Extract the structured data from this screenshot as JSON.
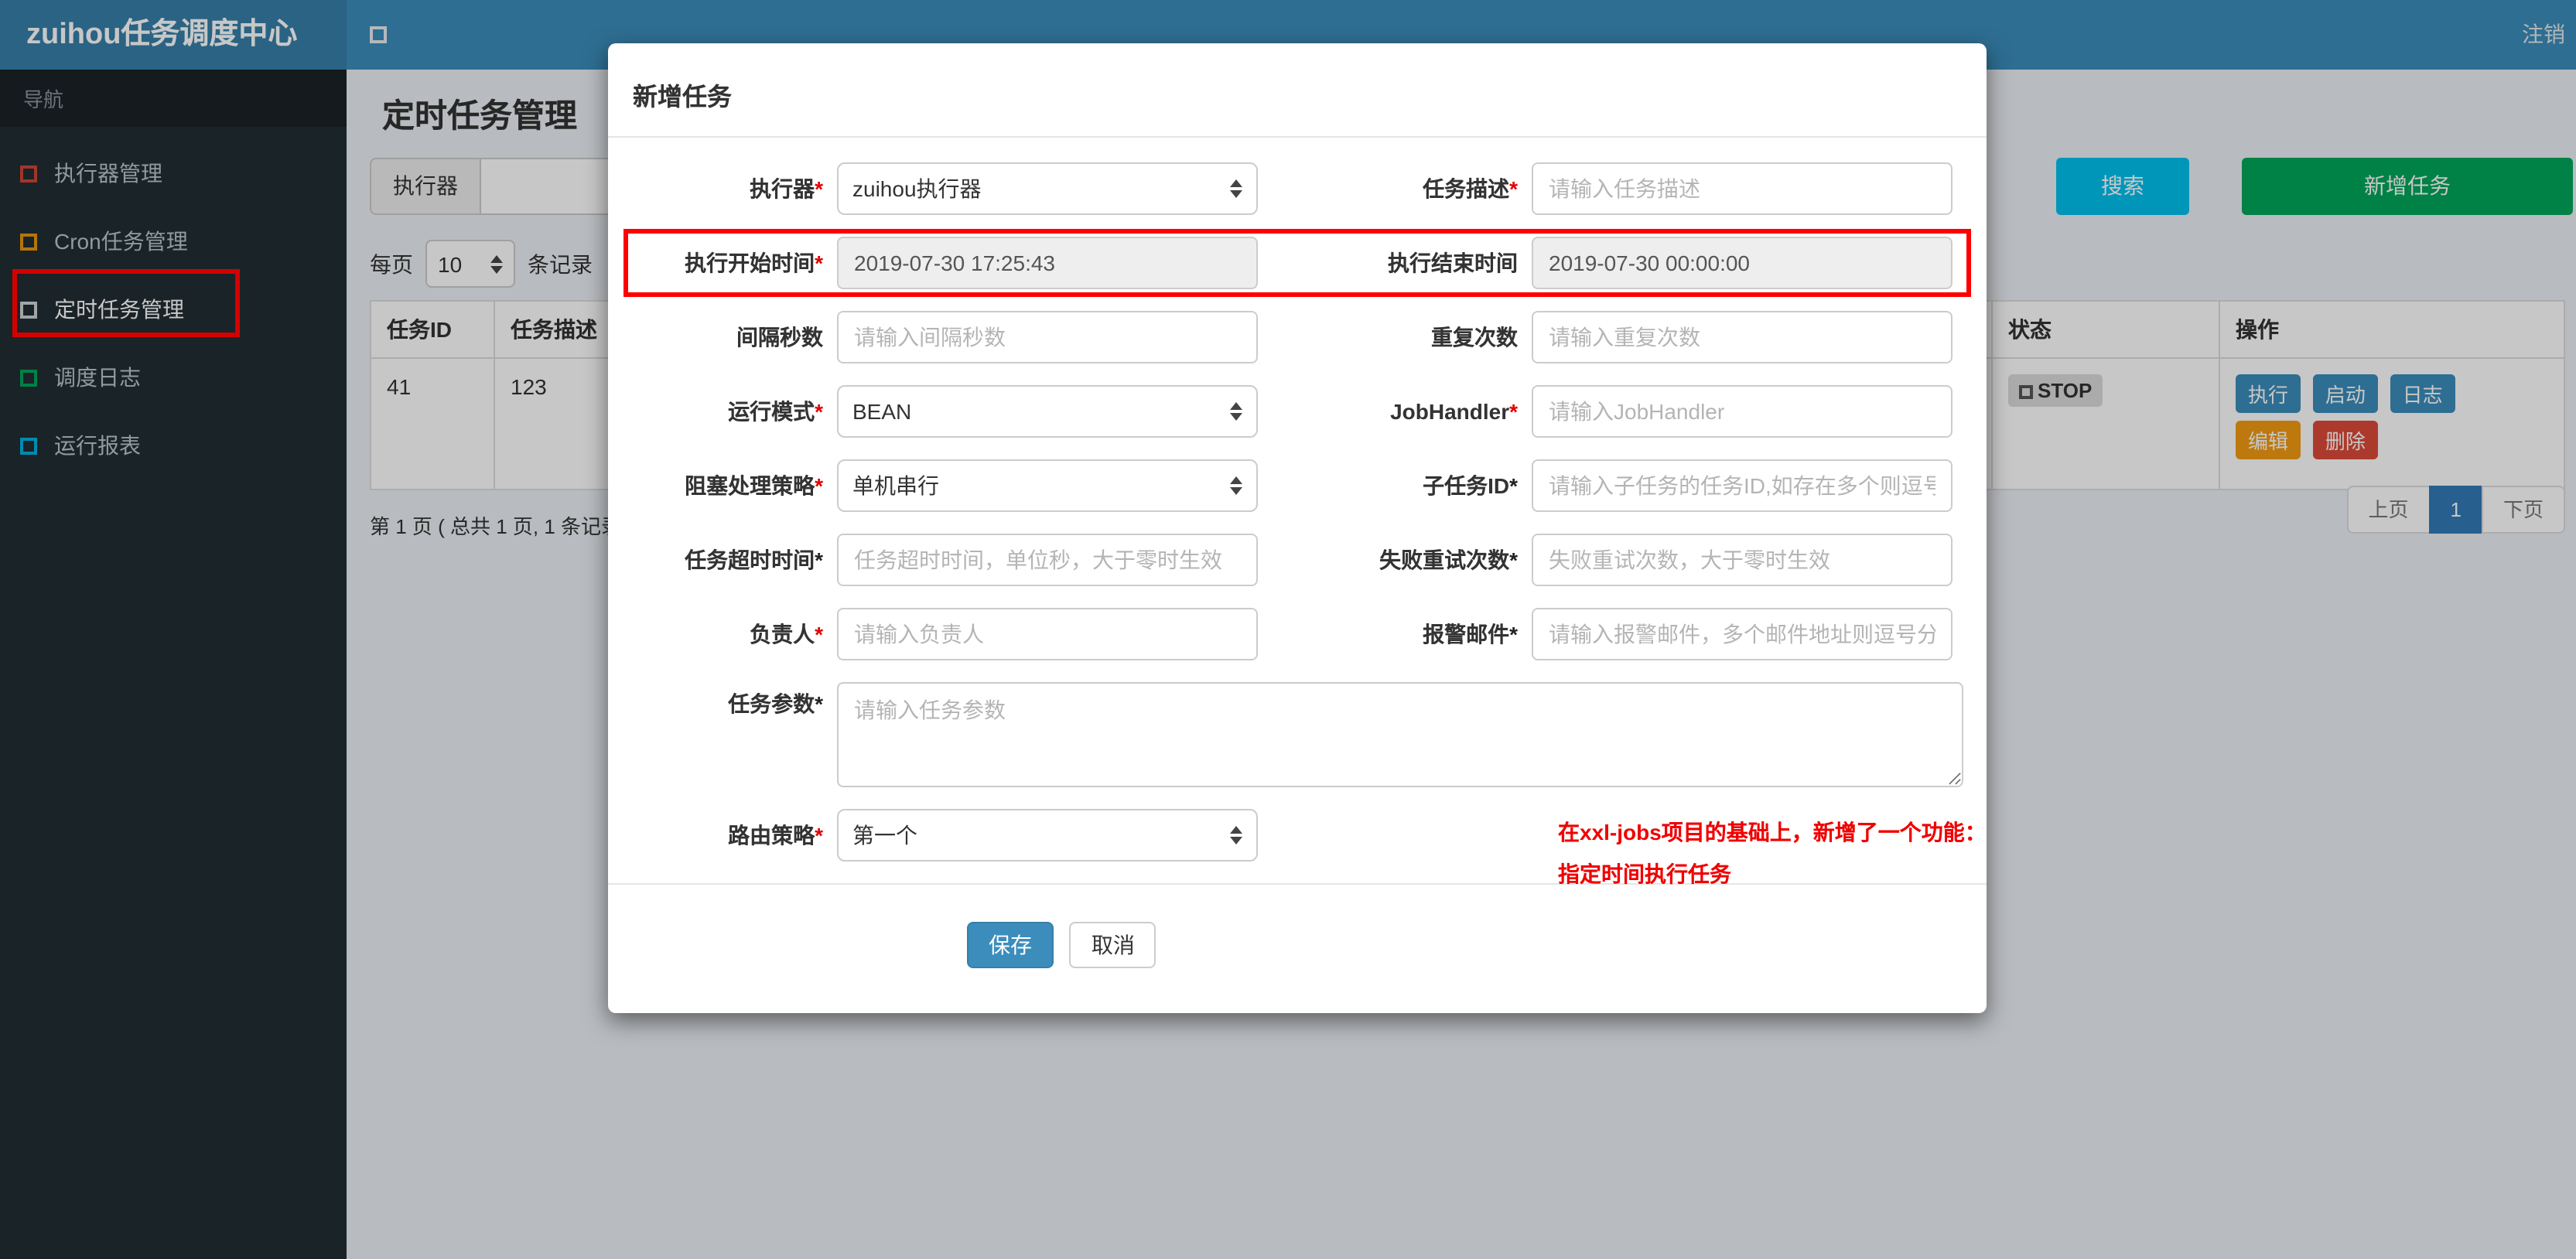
{
  "colors": {
    "navbar": "#3c8dbc",
    "brand_bg": "#367fa9",
    "sidebar_bg": "#222d32",
    "primary": "#3c8dbc",
    "info": "#00c0ef",
    "success": "#00a65a",
    "warning": "#f39c12",
    "danger": "#dd4b39",
    "pagination_active": "#337ab7",
    "annotation_red": "#ff0000",
    "readonly_bg": "#eeeeee"
  },
  "brand": {
    "title": "zuihou任务调度中心"
  },
  "navbar": {
    "logout": "注销"
  },
  "sidebar": {
    "header": "导航",
    "items": [
      {
        "label": "执行器管理",
        "icon": "red-square-icon",
        "color": "#dd4b39"
      },
      {
        "label": "Cron任务管理",
        "icon": "orange-square-icon",
        "color": "#f39c12"
      },
      {
        "label": "定时任务管理",
        "icon": "gray-square-icon",
        "color": "#d2d6de",
        "active": true,
        "annotated": true
      },
      {
        "label": "调度日志",
        "icon": "green-square-icon",
        "color": "#00a65a"
      },
      {
        "label": "运行报表",
        "icon": "cyan-square-icon",
        "color": "#00c0ef"
      }
    ]
  },
  "page": {
    "title": "定时任务管理",
    "filter": {
      "addon": "执行器",
      "input_value": ""
    },
    "search_button": "搜索",
    "add_button": "新增任务",
    "per_page": {
      "prefix": "每页",
      "value": "10",
      "suffix": "条记录"
    },
    "table": {
      "headers": [
        "任务ID",
        "任务描述",
        "状态",
        "操作"
      ],
      "row": {
        "id": "41",
        "desc": "123",
        "status": "STOP",
        "ops_line1": [
          "执行",
          "启动",
          "日志"
        ],
        "ops_line2": [
          "编辑",
          "删除"
        ]
      }
    },
    "pagination": {
      "info": "第 1 页 ( 总共 1 页, 1 条记录 )",
      "prev": "上页",
      "page": "1",
      "next": "下页"
    }
  },
  "modal": {
    "title": "新增任务",
    "rows": [
      {
        "label1": "执行器",
        "req1": "*",
        "value1": "zuihou执行器",
        "label2": "任务描述",
        "req2": "*",
        "ph2": "请输入任务描述"
      },
      {
        "label1": "执行开始时间",
        "req1": "*",
        "value1": "2019-07-30 17:25:43",
        "label2": "执行结束时间",
        "req2": "",
        "value2": "2019-07-30 00:00:00",
        "highlighted": true
      },
      {
        "label1": "间隔秒数",
        "req1": "",
        "ph1": "请输入间隔秒数",
        "label2": "重复次数",
        "req2": "",
        "ph2": "请输入重复次数"
      },
      {
        "label1": "运行模式",
        "req1": "*",
        "value1": "BEAN",
        "label2": "JobHandler",
        "req2": "*",
        "ph2": "请输入JobHandler"
      },
      {
        "label1": "阻塞处理策略",
        "req1": "*",
        "value1": "单机串行",
        "label2": "子任务ID",
        "req2": "*",
        "ph2": "请输入子任务的任务ID,如存在多个则逗号分隔"
      },
      {
        "label1": "任务超时时间",
        "req1": "*",
        "ph1": "任务超时时间，单位秒，大于零时生效",
        "label2": "失败重试次数",
        "req2": "*",
        "ph2": "失败重试次数，大于零时生效"
      },
      {
        "label1": "负责人",
        "req1": "*",
        "ph1": "请输入负责人",
        "label2": "报警邮件",
        "req2": "*",
        "ph2": "请输入报警邮件，多个邮件地址则逗号分隔"
      }
    ],
    "param_row": {
      "label": "任务参数",
      "req": "*",
      "placeholder": "请输入任务参数"
    },
    "route_row": {
      "label": "路由策略",
      "req": "*",
      "value": "第一个",
      "note_line1": "在xxl-jobs项目的基础上，新增了一个功能：",
      "note_line2": "指定时间执行任务"
    },
    "footer": {
      "save": "保存",
      "cancel": "取消"
    }
  }
}
